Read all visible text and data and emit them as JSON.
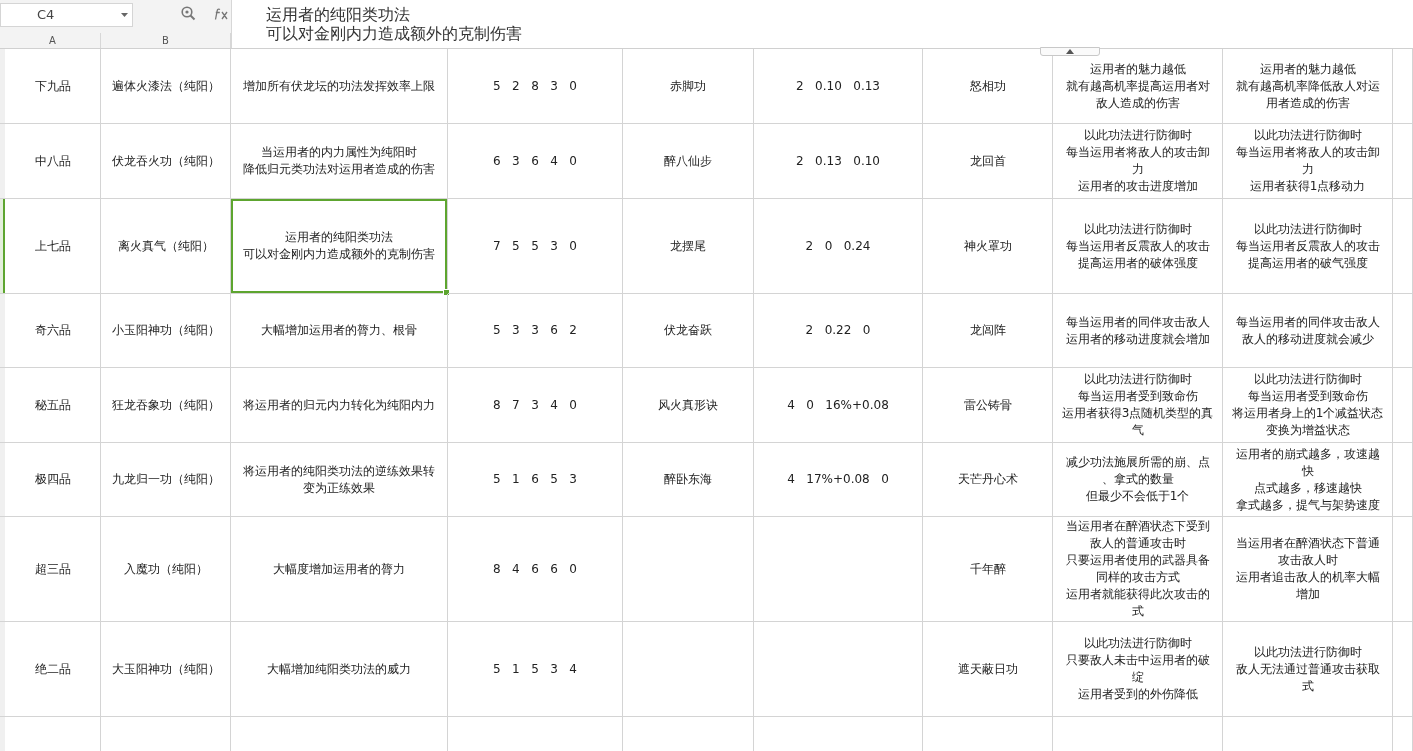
{
  "name_box": {
    "value": "C4"
  },
  "formula_bar": {
    "lines": [
      "运用者的纯阳类功法",
      "可以对金刚内力造成额外的克制伤害"
    ]
  },
  "column_headers": [
    {
      "label": "A"
    },
    {
      "label": "B"
    }
  ],
  "rows": [
    {
      "selected": false,
      "cells": [
        {
          "lines": [
            "下九品"
          ],
          "selected": false
        },
        {
          "lines": [
            "遍体火漆法（纯阳）"
          ],
          "selected": false
        },
        {
          "lines": [
            "增加所有伏龙坛的功法发挥效率上限"
          ],
          "selected": false
        },
        {
          "lines": [
            "5   2   8   3   0"
          ],
          "selected": false
        },
        {
          "lines": [
            "赤脚功"
          ],
          "selected": false
        },
        {
          "lines": [
            "2   0.10   0.13"
          ],
          "selected": false
        },
        {
          "lines": [
            "怒相功"
          ],
          "selected": false
        },
        {
          "lines": [
            "运用者的魅力越低",
            "就有越高机率提高运用者对",
            "敌人造成的伤害"
          ],
          "selected": false
        },
        {
          "lines": [
            "运用者的魅力越低",
            "就有越高机率降低敌人对运",
            "用者造成的伤害"
          ],
          "selected": false
        }
      ]
    },
    {
      "selected": false,
      "cells": [
        {
          "lines": [
            "中八品"
          ],
          "selected": false
        },
        {
          "lines": [
            "伏龙吞火功（纯阳）"
          ],
          "selected": false
        },
        {
          "lines": [
            "当运用者的内力属性为纯阳时",
            "降低归元类功法对运用者造成的伤害"
          ],
          "selected": false
        },
        {
          "lines": [
            "6   3   6   4   0"
          ],
          "selected": false
        },
        {
          "lines": [
            "醉八仙步"
          ],
          "selected": false
        },
        {
          "lines": [
            "2   0.13   0.10"
          ],
          "selected": false
        },
        {
          "lines": [
            "龙回首"
          ],
          "selected": false
        },
        {
          "lines": [
            "以此功法进行防御时",
            "每当运用者将敌人的攻击卸",
            "力",
            "运用者的攻击进度增加"
          ],
          "selected": false
        },
        {
          "lines": [
            "以此功法进行防御时",
            "每当运用者将敌人的攻击卸",
            "力",
            "运用者获得1点移动力"
          ],
          "selected": false
        }
      ]
    },
    {
      "selected": true,
      "cells": [
        {
          "lines": [
            "上七品"
          ],
          "selected": false
        },
        {
          "lines": [
            "离火真气（纯阳）"
          ],
          "selected": false
        },
        {
          "lines": [
            "运用者的纯阳类功法",
            "可以对金刚内力造成额外的克制伤害"
          ],
          "selected": true
        },
        {
          "lines": [
            "7   5   5   3   0"
          ],
          "selected": false
        },
        {
          "lines": [
            "龙摆尾"
          ],
          "selected": false
        },
        {
          "lines": [
            "2   0   0.24"
          ],
          "selected": false
        },
        {
          "lines": [
            "神火罩功"
          ],
          "selected": false
        },
        {
          "lines": [
            "以此功法进行防御时",
            "每当运用者反震敌人的攻击",
            "提高运用者的破体强度"
          ],
          "selected": false
        },
        {
          "lines": [
            "以此功法进行防御时",
            "每当运用者反震敌人的攻击",
            "提高运用者的破气强度"
          ],
          "selected": false
        }
      ]
    },
    {
      "selected": false,
      "cells": [
        {
          "lines": [
            "奇六品"
          ],
          "selected": false
        },
        {
          "lines": [
            "小玉阳神功（纯阳）"
          ],
          "selected": false
        },
        {
          "lines": [
            "大幅增加运用者的膂力、根骨"
          ],
          "selected": false
        },
        {
          "lines": [
            "5   3   3   6   2"
          ],
          "selected": false
        },
        {
          "lines": [
            "伏龙奋跃"
          ],
          "selected": false
        },
        {
          "lines": [
            "2   0.22   0"
          ],
          "selected": false
        },
        {
          "lines": [
            "龙闾阵"
          ],
          "selected": false
        },
        {
          "lines": [
            "每当运用者的同伴攻击敌人",
            "运用者的移动进度就会增加"
          ],
          "selected": false
        },
        {
          "lines": [
            "每当运用者的同伴攻击敌人",
            "敌人的移动进度就会减少"
          ],
          "selected": false
        }
      ]
    },
    {
      "selected": false,
      "cells": [
        {
          "lines": [
            "秘五品"
          ],
          "selected": false
        },
        {
          "lines": [
            "狂龙吞象功（纯阳）"
          ],
          "selected": false
        },
        {
          "lines": [
            "将运用者的归元内力转化为纯阳内力"
          ],
          "selected": false
        },
        {
          "lines": [
            "8   7   3   4   0"
          ],
          "selected": false
        },
        {
          "lines": [
            "风火真形诀"
          ],
          "selected": false
        },
        {
          "lines": [
            "4   0   16%+0.08"
          ],
          "selected": false
        },
        {
          "lines": [
            "雷公铸骨"
          ],
          "selected": false
        },
        {
          "lines": [
            "以此功法进行防御时",
            "每当运用者受到致命伤",
            "运用者获得3点随机类型的真",
            "气"
          ],
          "selected": false
        },
        {
          "lines": [
            "以此功法进行防御时",
            "每当运用者受到致命伤",
            "将运用者身上的1个减益状态",
            "变换为增益状态"
          ],
          "selected": false
        }
      ]
    },
    {
      "selected": false,
      "cells": [
        {
          "lines": [
            "极四品"
          ],
          "selected": false
        },
        {
          "lines": [
            "九龙归一功（纯阳）"
          ],
          "selected": false
        },
        {
          "lines": [
            "将运用者的纯阳类功法的逆练效果转",
            "变为正练效果"
          ],
          "selected": false
        },
        {
          "lines": [
            "5   1   6   5   3"
          ],
          "selected": false
        },
        {
          "lines": [
            "醉卧东海"
          ],
          "selected": false
        },
        {
          "lines": [
            "4   17%+0.08   0"
          ],
          "selected": false
        },
        {
          "lines": [
            "天芒丹心术"
          ],
          "selected": false
        },
        {
          "lines": [
            "减少功法施展所需的崩、点",
            "、拿式的数量",
            "但最少不会低于1个"
          ],
          "selected": false
        },
        {
          "lines": [
            "运用者的崩式越多，攻速越",
            "快",
            "点式越多，移速越快",
            "拿式越多，提气与架势速度"
          ],
          "selected": false
        }
      ]
    },
    {
      "selected": false,
      "cells": [
        {
          "lines": [
            "超三品"
          ],
          "selected": false
        },
        {
          "lines": [
            "入魔功（纯阳）"
          ],
          "selected": false
        },
        {
          "lines": [
            "大幅度增加运用者的膂力"
          ],
          "selected": false
        },
        {
          "lines": [
            "8   4   6   6   0"
          ],
          "selected": false
        },
        {
          "selected": false
        },
        {
          "selected": false
        },
        {
          "lines": [
            "千年醉"
          ],
          "selected": false
        },
        {
          "lines": [
            "当运用者在醉酒状态下受到",
            "敌人的普通攻击时",
            "只要运用者使用的武器具备",
            "同样的攻击方式",
            "运用者就能获得此次攻击的",
            "式"
          ],
          "selected": false
        },
        {
          "lines": [
            "当运用者在醉酒状态下普通",
            "攻击敌人时",
            "运用者追击敌人的机率大幅",
            "增加"
          ],
          "selected": false
        }
      ]
    },
    {
      "selected": false,
      "cells": [
        {
          "lines": [
            "绝二品"
          ],
          "selected": false
        },
        {
          "lines": [
            "大玉阳神功（纯阳）"
          ],
          "selected": false
        },
        {
          "lines": [
            "大幅增加纯阳类功法的威力"
          ],
          "selected": false
        },
        {
          "lines": [
            "5   1   5   3   4"
          ],
          "selected": false
        },
        {
          "selected": false
        },
        {
          "selected": false
        },
        {
          "lines": [
            "遮天蔽日功"
          ],
          "selected": false
        },
        {
          "lines": [
            "以此功法进行防御时",
            "只要敌人未击中运用者的破",
            "绽",
            "运用者受到的外伤降低"
          ],
          "selected": false
        },
        {
          "lines": [
            "以此功法进行防御时",
            "敌人无法通过普通攻击获取",
            "式"
          ],
          "selected": false
        }
      ]
    },
    {
      "selected": false,
      "cells": [
        {
          "selected": false
        },
        {
          "selected": false
        },
        {
          "selected": false
        },
        {
          "selected": false
        },
        {
          "selected": false
        },
        {
          "selected": false
        },
        {
          "selected": false
        },
        {
          "selected": false
        },
        {
          "selected": false
        }
      ]
    }
  ]
}
